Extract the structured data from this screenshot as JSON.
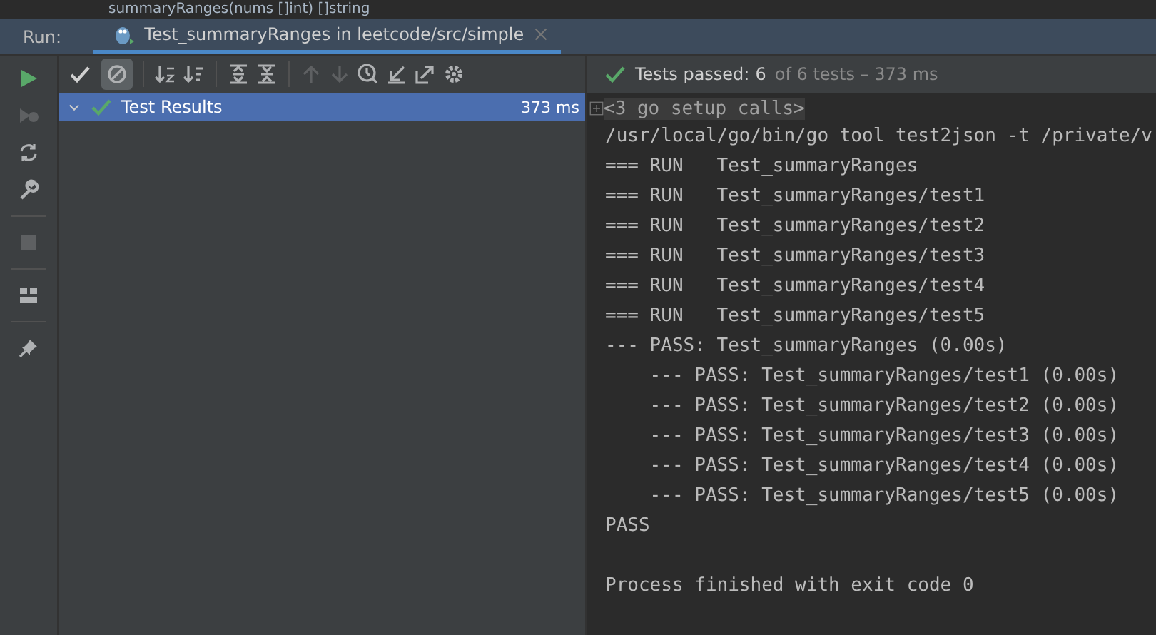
{
  "editor_breadcrumb": "summaryRanges(nums []int) []string",
  "run_bar": {
    "label": "Run:",
    "tab": {
      "title": "Test_summaryRanges in leetcode/src/simple",
      "selected": true
    }
  },
  "toolbar": {
    "show_passed": {
      "on": false
    },
    "show_ignored": {
      "on": true
    }
  },
  "status": {
    "passed_label": "Tests passed:",
    "passed": "6",
    "rest": "of 6 tests – 373 ms"
  },
  "tree": {
    "items": [
      {
        "label": "Test Results",
        "time": "373 ms",
        "selected": true,
        "expanded": true,
        "passed": true
      }
    ]
  },
  "console": {
    "folded": "<3 go setup calls>",
    "lines": [
      "/usr/local/go/bin/go tool test2json -t /private/v",
      "=== RUN   Test_summaryRanges",
      "=== RUN   Test_summaryRanges/test1",
      "=== RUN   Test_summaryRanges/test2",
      "=== RUN   Test_summaryRanges/test3",
      "=== RUN   Test_summaryRanges/test4",
      "=== RUN   Test_summaryRanges/test5",
      "--- PASS: Test_summaryRanges (0.00s)",
      "    --- PASS: Test_summaryRanges/test1 (0.00s)",
      "    --- PASS: Test_summaryRanges/test2 (0.00s)",
      "    --- PASS: Test_summaryRanges/test3 (0.00s)",
      "    --- PASS: Test_summaryRanges/test4 (0.00s)",
      "    --- PASS: Test_summaryRanges/test5 (0.00s)",
      "PASS"
    ],
    "exit_message": "Process finished with exit code 0"
  }
}
